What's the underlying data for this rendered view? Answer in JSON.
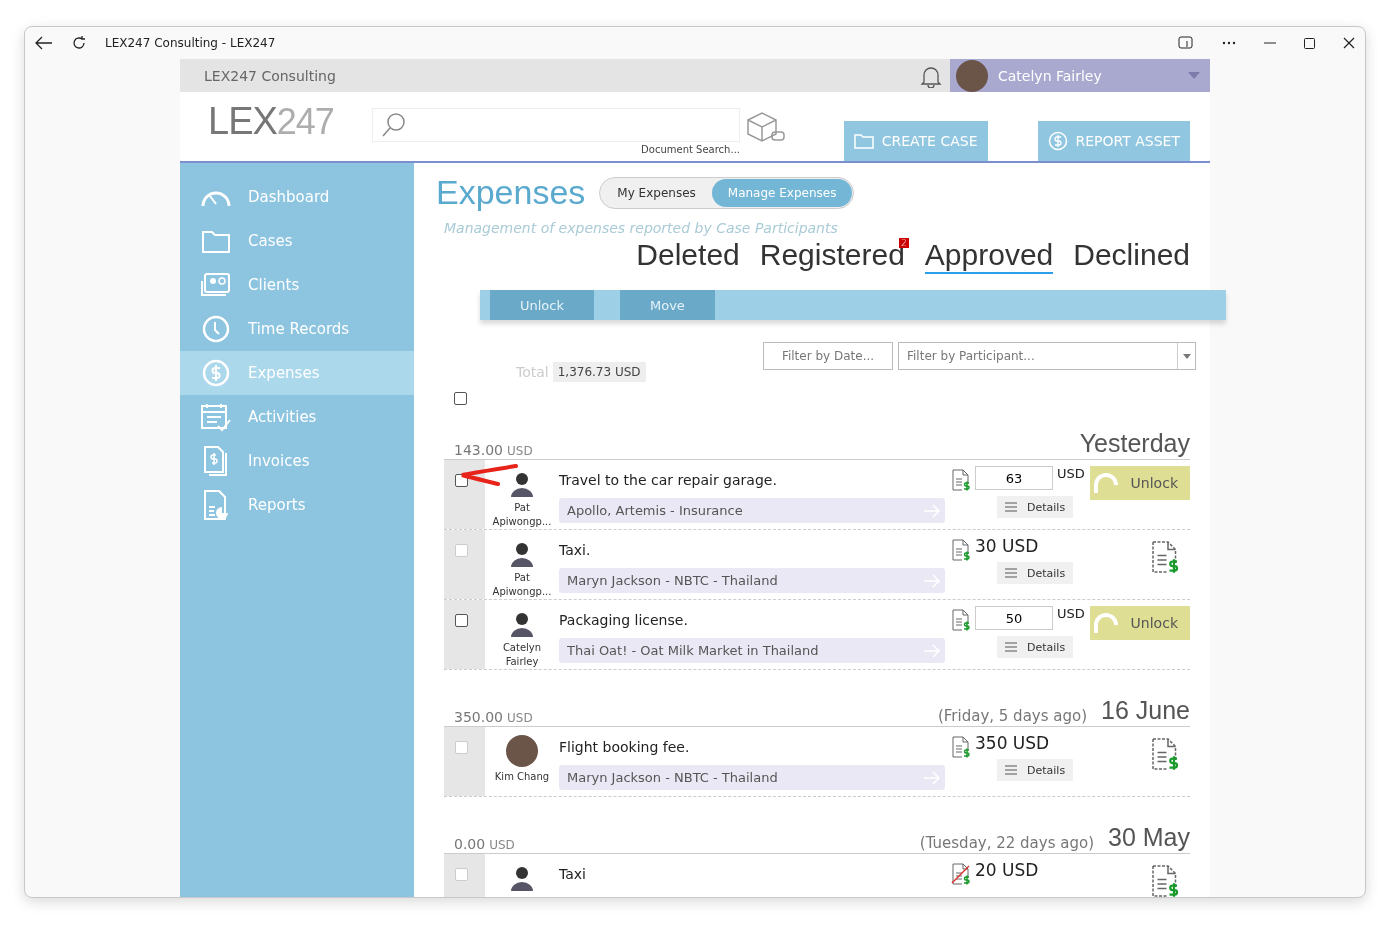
{
  "window": {
    "title": "LEX247 Consulting - LEX247"
  },
  "header": {
    "org": "LEX247 Consulting",
    "user": "Catelyn Fairley",
    "logo_main": "LEX",
    "logo_light": "247",
    "search_caption": "Document Search...",
    "actions": [
      "CREATE CASE",
      "REPORT ASSET"
    ]
  },
  "sidebar": {
    "items": [
      {
        "label": "Dashboard",
        "selected": false
      },
      {
        "label": "Cases",
        "selected": false
      },
      {
        "label": "Clients",
        "selected": false
      },
      {
        "label": "Time Records",
        "selected": false
      },
      {
        "label": "Expenses",
        "selected": true
      },
      {
        "label": "Activities",
        "selected": false
      },
      {
        "label": "Invoices",
        "selected": false
      },
      {
        "label": "Reports",
        "selected": false
      }
    ]
  },
  "page": {
    "title": "Expenses",
    "views": [
      {
        "label": "My Expenses",
        "selected": false
      },
      {
        "label": "Manage Expenses",
        "selected": true
      }
    ],
    "subtitle": "Management of expenses reported by Case Participants"
  },
  "status_tabs": [
    {
      "label": "Deleted",
      "selected": false
    },
    {
      "label": "Registered",
      "selected": false,
      "badge": "2"
    },
    {
      "label": "Approved",
      "selected": true
    },
    {
      "label": "Declined",
      "selected": false
    }
  ],
  "toolbar": {
    "buttons": [
      {
        "label": "Unlock",
        "disabled": true
      },
      {
        "label": "Move",
        "disabled": true
      }
    ]
  },
  "filters": {
    "date_placeholder": "Filter by Date...",
    "participant_placeholder": "Filter by Participant..."
  },
  "total": {
    "label": "Total",
    "value": "1,376.73 USD"
  },
  "select_all": {
    "checked": false
  },
  "groups": [
    {
      "amount": "143.00",
      "currency": "USD",
      "date": "Yesterday",
      "rows": [
        {
          "kind": "editable",
          "checked": false,
          "disabled": false,
          "person_first": "Pat",
          "person_last": "Apiwongp...",
          "description": "Travel to the car repair garage.",
          "case": "Apollo, Artemis - Insurance",
          "receipt": true,
          "amount": "63",
          "currency": "USD",
          "action": "Unlock",
          "details": "Details"
        },
        {
          "kind": "fixed",
          "checked": false,
          "disabled": true,
          "person_first": "Pat",
          "person_last": "Apiwongp...",
          "description": "Taxi.",
          "case": "Maryn Jackson - NBTC - Thailand",
          "receipt": true,
          "amount": "30 USD",
          "details": "Details"
        },
        {
          "kind": "editable",
          "checked": false,
          "disabled": false,
          "person_first": "Catelyn",
          "person_last": "Fairley",
          "description": "Packaging license.",
          "case": "Thai Oat! - Oat Milk Market in Thailand",
          "receipt": true,
          "amount": "50",
          "currency": "USD",
          "action": "Unlock",
          "details": "Details"
        }
      ]
    },
    {
      "amount": "350.00",
      "currency": "USD",
      "relative": "(Friday, 5 days ago)",
      "date": "16 June",
      "rows": [
        {
          "kind": "fixed",
          "checked": false,
          "disabled": true,
          "person_first": "Kim Chang",
          "description": "Flight booking fee.",
          "case": "Maryn Jackson - NBTC - Thailand",
          "receipt": true,
          "amount": "350 USD",
          "details": "Details"
        }
      ]
    },
    {
      "amount": "0.00",
      "currency": "USD",
      "relative": "(Tuesday, 22 days ago)",
      "date": "30 May",
      "rows": [
        {
          "kind": "fixed",
          "checked": false,
          "disabled": true,
          "description": "Taxi",
          "receipt": false,
          "amount": "20 USD"
        }
      ]
    }
  ]
}
